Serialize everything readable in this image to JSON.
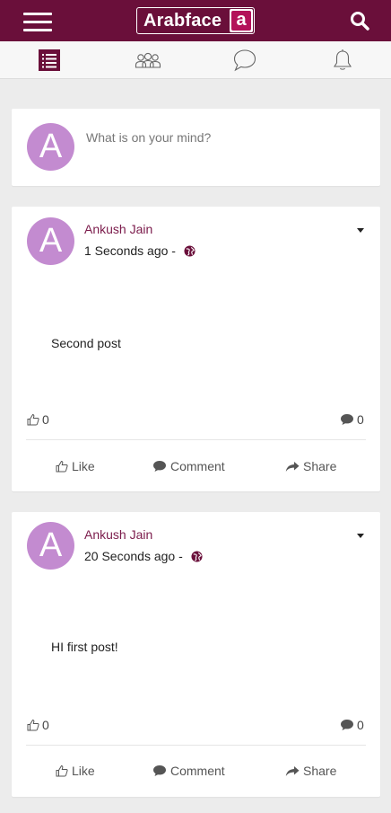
{
  "app": {
    "logo_text": "Arabface",
    "logo_letter": "a"
  },
  "tabs": [
    {
      "icon": "list-icon",
      "active": true
    },
    {
      "icon": "friends-icon",
      "active": false
    },
    {
      "icon": "chat-icon",
      "active": false
    },
    {
      "icon": "bell-icon",
      "active": false
    }
  ],
  "composer": {
    "avatar_letter": "A",
    "placeholder": "What is on your mind?"
  },
  "posts": [
    {
      "avatar_letter": "A",
      "author": "Ankush Jain",
      "time": "1 Seconds ago -",
      "text": "Second post",
      "likes": "0",
      "comments": "0"
    },
    {
      "avatar_letter": "A",
      "author": "Ankush Jain",
      "time": "20 Seconds ago -",
      "text": "HI first post!",
      "likes": "0",
      "comments": "0"
    }
  ],
  "actions": {
    "like": "Like",
    "comment": "Comment",
    "share": "Share"
  },
  "colors": {
    "brand": "#6a0f3a",
    "accent": "#b3125a",
    "avatar": "#c38bd0"
  }
}
